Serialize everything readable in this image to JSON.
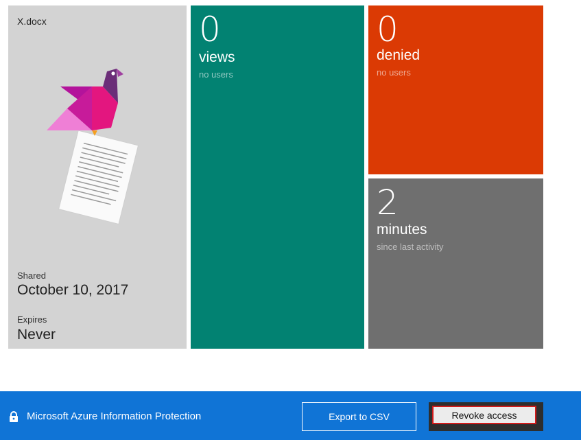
{
  "file_tile": {
    "file_name": "X.docx",
    "shared_label": "Shared",
    "shared_date": "October 10, 2017",
    "expires_label": "Expires",
    "expires_value": "Never",
    "illustration_icon": "bird-on-document-icon"
  },
  "views_tile": {
    "count": "0",
    "unit": "views",
    "sub": "no users",
    "color": "#028272"
  },
  "denied_tile": {
    "count": "0",
    "unit": "denied",
    "sub": "no users",
    "color": "#db3a04"
  },
  "minutes_tile": {
    "count": "2",
    "unit": "minutes",
    "sub": "since last activity",
    "color": "#6f6f6f"
  },
  "footer": {
    "brand_icon": "lock-icon",
    "brand_text": "Microsoft Azure Information Protection",
    "export_label": "Export to CSV",
    "revoke_label": "Revoke access",
    "bar_color": "#1074d6",
    "highlight_color": "#d11a1a"
  }
}
